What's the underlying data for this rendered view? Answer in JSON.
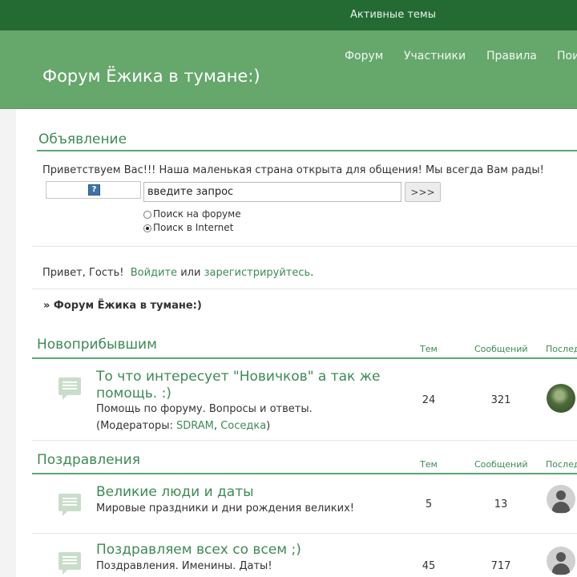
{
  "topbar": {
    "active_topics": "Активные темы"
  },
  "header": {
    "site_title": "Форум Ёжика в тумане:)",
    "nav": [
      "Форум",
      "Участники",
      "Правила",
      "Пои"
    ]
  },
  "announcement": {
    "title": "Объявление",
    "text": "Приветствуем Вас!!! Наша маленькая страна открыта для общения! Мы всегда Вам рады!",
    "help_glyph": "?",
    "search_placeholder": "введите запрос",
    "search_value": "введите запрос",
    "search_button": ">>>",
    "options": [
      {
        "label": "Поиск на форуме",
        "checked": false
      },
      {
        "label": "Поиск в Internet",
        "checked": true
      }
    ]
  },
  "greeting": {
    "prefix": "Привет, Гость!",
    "login": "Войдите",
    "or": "или",
    "register": "зарегистрируйтесь",
    "suffix": "."
  },
  "breadcrumb": "» Форум Ёжика в тумане:)",
  "columns": {
    "topics": "Тем",
    "posts": "Сообщений",
    "last": "Послед"
  },
  "categories": [
    {
      "title": "Новоприбывшим",
      "forums": [
        {
          "name": "То что интересует \"Новичков\" а так же помощь. :)",
          "desc": "Помощь по форуму. Вопросы и ответы.",
          "mods_prefix": "(Модераторы:",
          "mods": [
            "SDRAM",
            "Соседка"
          ],
          "mods_sep": ",",
          "mods_suffix": ")",
          "topics": "24",
          "posts": "321",
          "avatar": "photo"
        }
      ]
    },
    {
      "title": "Поздравления",
      "forums": [
        {
          "name": "Великие люди и даты",
          "desc": "Мировые праздники и дни рождения великих!",
          "topics": "5",
          "posts": "13",
          "avatar": "default"
        },
        {
          "name": "Поздравляем всех со всем ;)",
          "desc": "Поздравления. Именины. Даты!",
          "topics": "45",
          "posts": "717",
          "avatar": "default"
        }
      ]
    }
  ],
  "colors": {
    "dark_green": "#236a33",
    "header_green": "#66a76c",
    "link_green": "#3e8a55",
    "line_green": "#5aa874"
  }
}
